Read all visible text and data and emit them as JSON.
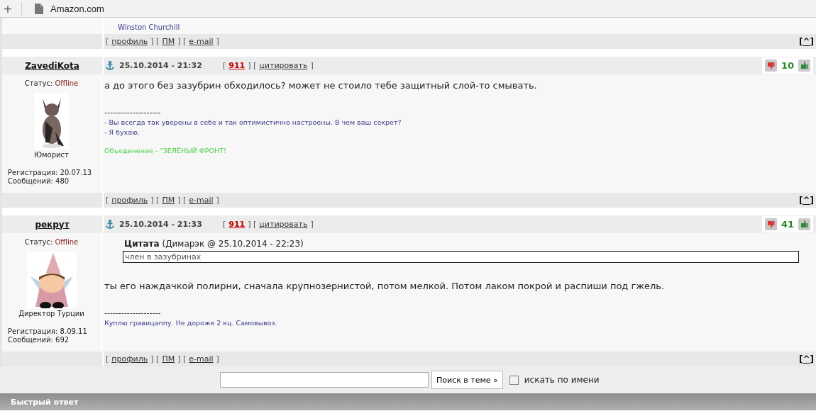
{
  "browser_tab": {
    "new_tab": "+",
    "title": "Amazon.com"
  },
  "previous_post": {
    "signature_author": "Winston Churchill",
    "links": [
      {
        "text": "[",
        "kind": "bracket"
      },
      {
        "text": "профиль",
        "kind": "link"
      },
      {
        "text": "] [",
        "kind": "bracket"
      },
      {
        "text": "ПМ",
        "kind": "link"
      },
      {
        "text": "] [",
        "kind": "bracket"
      },
      {
        "text": "e-mail",
        "kind": "link"
      },
      {
        "text": "]",
        "kind": "bracket"
      }
    ],
    "top_link": {
      "open": "[",
      "text": "^",
      "close": "]"
    }
  },
  "posts": [
    {
      "author": "ZavediKota",
      "date": "25.10.2014 - 21:32",
      "actions": [
        {
          "text": "[",
          "kind": "bracket"
        },
        {
          "text": "911",
          "kind": "report"
        },
        {
          "text": "] [",
          "kind": "bracket"
        },
        {
          "text": "цитировать",
          "kind": "link"
        },
        {
          "text": "]",
          "kind": "bracket"
        }
      ],
      "rating": "10",
      "status_label": "Статус:",
      "status": "Offline",
      "rank": "Юморист",
      "registration_label": "Регистрация:",
      "registration": "20.07.13",
      "messages_label": "Сообщений:",
      "messages": "480",
      "body": "а до этого без зазубрин обходилось? может не стоило тебе защитный слой-то смывать.",
      "signature": {
        "rule": "--------------------",
        "lines": [
          {
            "text": "- Вы всегда так уверены в себе и так оптимистично настроены. В чем ваш секрет?",
            "kind": "plain"
          },
          {
            "text": "- Я бухаю.",
            "kind": "plain"
          },
          {
            "text": "Объединение - \"ЗЕЛЁНЫЙ ФРОНТ!",
            "kind": "accent"
          }
        ]
      },
      "links": [
        {
          "text": "[",
          "kind": "bracket"
        },
        {
          "text": "профиль",
          "kind": "link"
        },
        {
          "text": "] [",
          "kind": "bracket"
        },
        {
          "text": "ПМ",
          "kind": "link"
        },
        {
          "text": "] [",
          "kind": "bracket"
        },
        {
          "text": "e-mail",
          "kind": "link"
        },
        {
          "text": "]",
          "kind": "bracket"
        }
      ],
      "top_link": {
        "open": "[",
        "text": "^",
        "close": "]"
      }
    },
    {
      "author": "рекрут",
      "date": "25.10.2014 - 21:33",
      "actions": [
        {
          "text": "[",
          "kind": "bracket"
        },
        {
          "text": "911",
          "kind": "report"
        },
        {
          "text": "] [",
          "kind": "bracket"
        },
        {
          "text": "цитировать",
          "kind": "link"
        },
        {
          "text": "]",
          "kind": "bracket"
        }
      ],
      "rating": "41",
      "status_label": "Статус:",
      "status": "Offline",
      "rank": "Директор Турции",
      "registration_label": "Регистрация:",
      "registration": "8.09.11",
      "messages_label": "Сообщений:",
      "messages": "692",
      "quote": {
        "title": "Цитата",
        "source": "(Димарэк @ 25.10.2014 - 22:23)",
        "text": "член в зазубринах"
      },
      "body": "ты его наждачкой полирни, сначала крупнозернистой, потом мелкой. Потом лаком покрой и распиши под гжель.",
      "signature": {
        "rule": "--------------------",
        "lines": [
          {
            "text": "Куплю гравицаппу. Не дороже 2 кц. Самовывоз.",
            "kind": "plain"
          }
        ]
      },
      "links": [
        {
          "text": "[",
          "kind": "bracket"
        },
        {
          "text": "профиль",
          "kind": "link"
        },
        {
          "text": "] [",
          "kind": "bracket"
        },
        {
          "text": "ПМ",
          "kind": "link"
        },
        {
          "text": "] [",
          "kind": "bracket"
        },
        {
          "text": "e-mail",
          "kind": "link"
        },
        {
          "text": "]",
          "kind": "bracket"
        }
      ],
      "top_link": {
        "open": "[",
        "text": "^",
        "close": "]"
      }
    }
  ],
  "search": {
    "button": "Поиск в теме »",
    "by_name": {
      "label": "искать по имени",
      "checked": false
    }
  },
  "quick_reply": {
    "title": "Быстрый ответ"
  }
}
